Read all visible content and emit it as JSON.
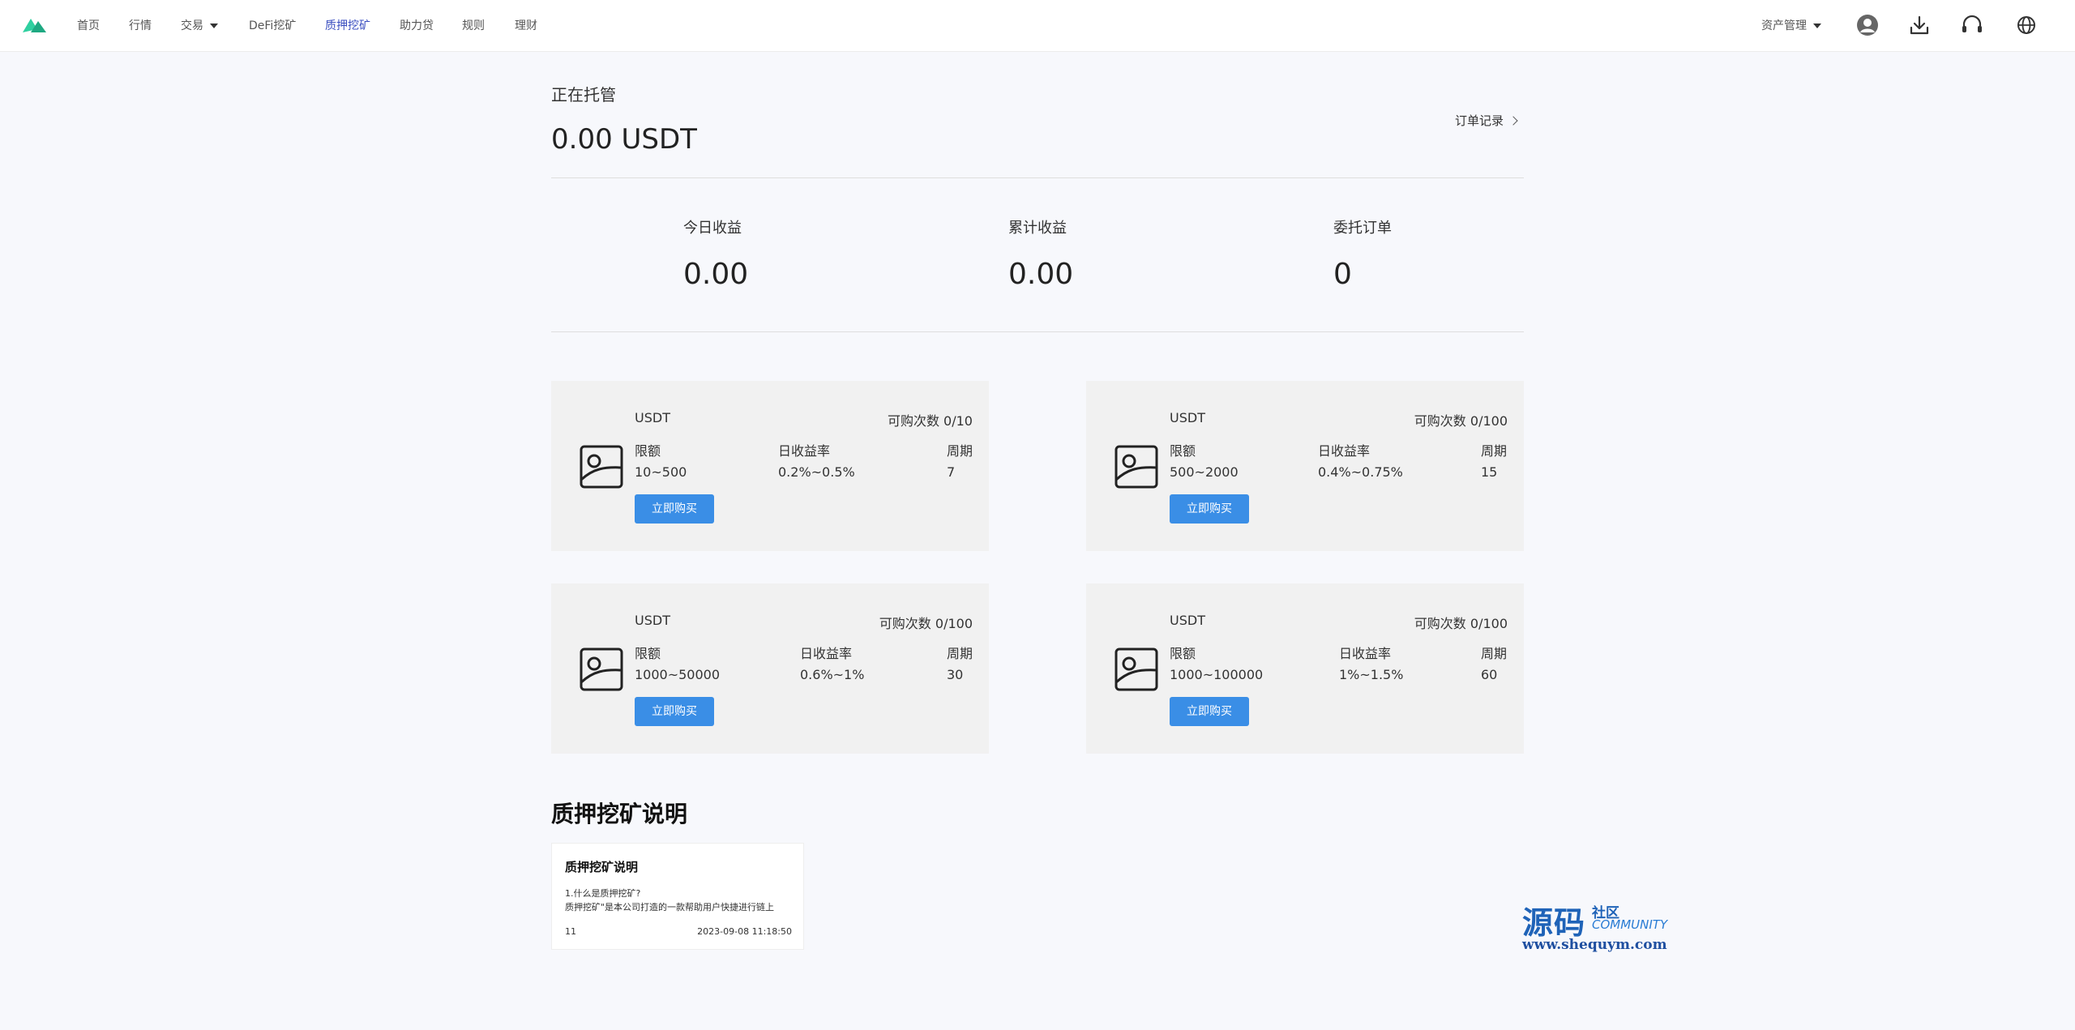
{
  "nav": {
    "items": [
      {
        "label": "首页"
      },
      {
        "label": "行情"
      },
      {
        "label": "交易"
      },
      {
        "label": "DeFi挖矿"
      },
      {
        "label": "质押挖矿"
      },
      {
        "label": "助力贷"
      },
      {
        "label": "规则"
      },
      {
        "label": "理财"
      }
    ],
    "asset_menu": "资产管理",
    "active_color": "#3b4fc0"
  },
  "custody": {
    "label": "正在托管",
    "amount": "0.00 USDT",
    "order_link": "订单记录"
  },
  "stats": [
    {
      "label": "今日收益",
      "value": "0.00"
    },
    {
      "label": "累计收益",
      "value": "0.00"
    },
    {
      "label": "委托订单",
      "value": "0"
    }
  ],
  "products": [
    {
      "coin": "USDT",
      "available": "可购次数 0/10",
      "limit_label": "限额",
      "limit": "10~500",
      "rate_label": "日收益率",
      "rate": "0.2%~0.5%",
      "period_label": "周期",
      "period": "7",
      "button": "立即购买"
    },
    {
      "coin": "USDT",
      "available": "可购次数 0/100",
      "limit_label": "限额",
      "limit": "500~2000",
      "rate_label": "日收益率",
      "rate": "0.4%~0.75%",
      "period_label": "周期",
      "period": "15",
      "button": "立即购买"
    },
    {
      "coin": "USDT",
      "available": "可购次数 0/100",
      "limit_label": "限额",
      "limit": "1000~50000",
      "rate_label": "日收益率",
      "rate": "0.6%~1%",
      "period_label": "周期",
      "period": "30",
      "button": "立即购买"
    },
    {
      "coin": "USDT",
      "available": "可购次数 0/100",
      "limit_label": "限额",
      "limit": "1000~100000",
      "rate_label": "日收益率",
      "rate": "1%~1.5%",
      "period_label": "周期",
      "period": "60",
      "button": "立即购买"
    }
  ],
  "explanation": {
    "title": "质押挖矿说明",
    "article": {
      "title": "质押挖矿说明",
      "line1": "1.什么是质押挖矿?",
      "line2": "质押挖矿\"是本公司打造的一款帮助用户快捷进行链上",
      "count": "11",
      "date": "2023-09-08 11:18:50"
    }
  },
  "watermark": {
    "big": "源码",
    "small": "社区",
    "community": "COMMUNITY",
    "url": "www.shequym.com"
  },
  "colors": {
    "button": "#3a8ee6",
    "card_bg": "#f1f1f1",
    "page_bg": "#f7f8fc"
  },
  "icons": [
    "logo-icon",
    "user-icon",
    "download-icon",
    "headset-icon",
    "globe-icon",
    "image-placeholder-icon"
  ]
}
